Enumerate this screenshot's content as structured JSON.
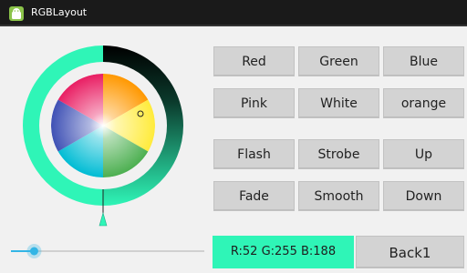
{
  "app": {
    "title": "RGBLayout"
  },
  "colors": {
    "accent": "#2ff5b7",
    "ring_dark": "#0d0d0d",
    "button_bg": "#d3d3d3",
    "slider_thumb": "#33b5e5"
  },
  "buttons": {
    "row1": [
      "Red",
      "Green",
      "Blue"
    ],
    "row2": [
      "Pink",
      "White",
      "orange"
    ],
    "row3": [
      "Flash",
      "Strobe",
      "Up"
    ],
    "row4": [
      "Fade",
      "Smooth",
      "Down"
    ]
  },
  "status": {
    "rgb_text": "R:52 G:255 B:188"
  },
  "back_button": {
    "label": "Back1"
  },
  "slider": {
    "value": 0.12
  }
}
